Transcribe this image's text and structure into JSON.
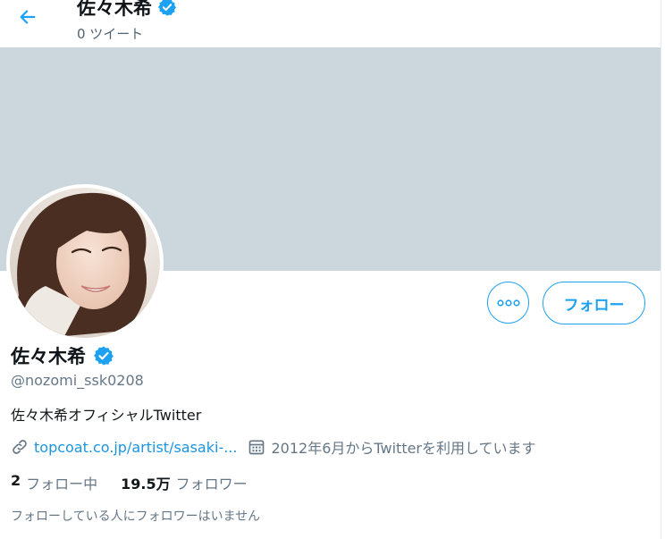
{
  "colors": {
    "accent": "#1da1f2",
    "banner": "#ccd6dd",
    "link": "#1b95e0"
  },
  "header": {
    "back_icon": "arrow-left-icon",
    "title": "佐々木希",
    "tweet_count": "0 ツイート"
  },
  "profile": {
    "name": "佐々木希",
    "verified_icon": "verified-badge-icon",
    "handle": "@nozomi_ssk0208",
    "bio": "佐々木希オフィシャルTwitter",
    "link_icon": "link-icon",
    "website": "topcoat.co.jp/artist/sasaki-...",
    "calendar_icon": "calendar-icon",
    "joined": "2012年6月からTwitterを利用しています"
  },
  "actions": {
    "more_icon": "more-options-icon",
    "follow_label": "フォロー"
  },
  "stats": {
    "following_count": "2",
    "following_label": "フォロー中",
    "followers_count": "19.5万",
    "followers_label": "フォロワー"
  },
  "known_followers": "フォローしている人にフォロワーはいません"
}
